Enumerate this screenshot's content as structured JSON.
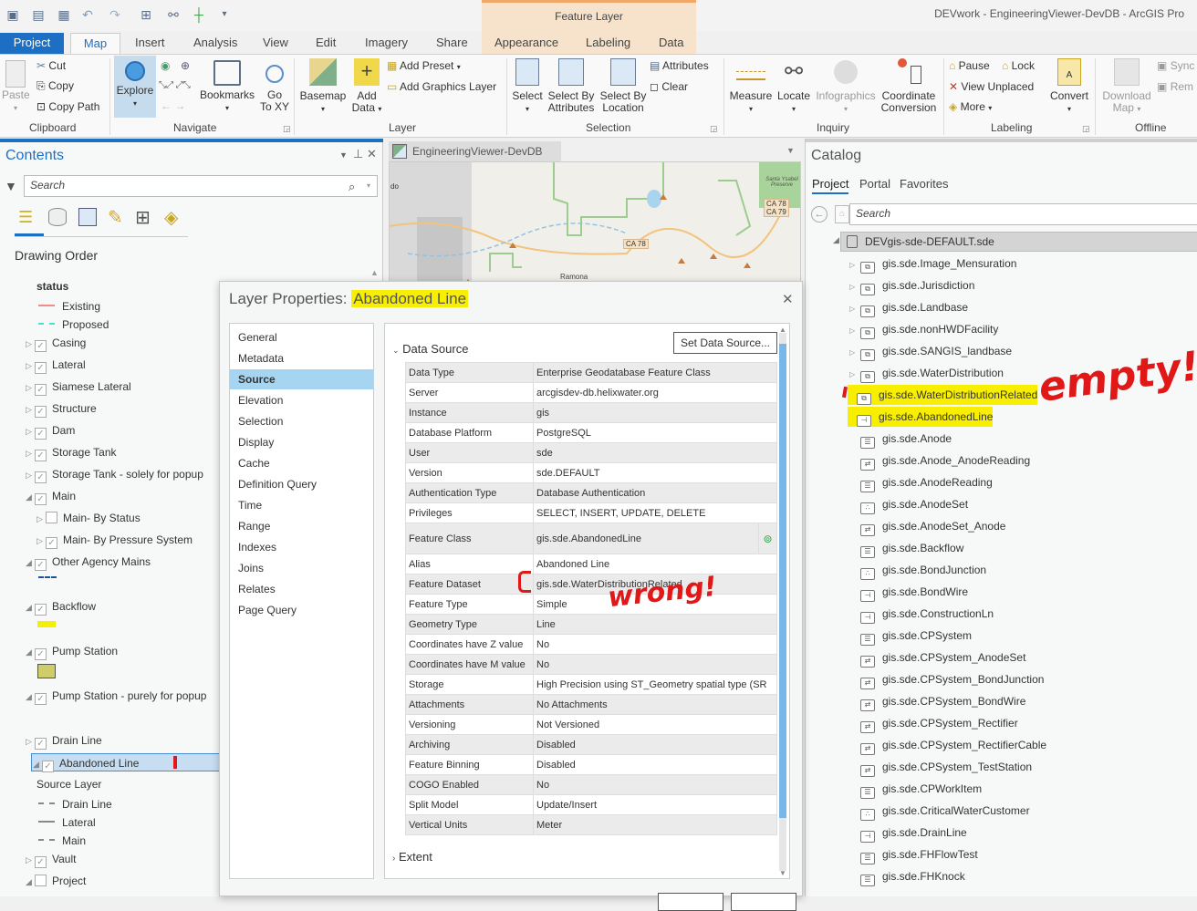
{
  "app": {
    "title": "DEVwork - EngineeringViewer-DevDB - ArcGIS Pro",
    "context_tab_group": "Feature Layer"
  },
  "ribbon_tabs": [
    "Project",
    "Map",
    "Insert",
    "Analysis",
    "View",
    "Edit",
    "Imagery",
    "Share",
    "Appearance",
    "Labeling",
    "Data"
  ],
  "ribbon": {
    "clipboard": {
      "label": "Clipboard",
      "paste": "Paste",
      "cut": "Cut",
      "copy": "Copy",
      "copy_path": "Copy Path"
    },
    "navigate": {
      "label": "Navigate",
      "explore": "Explore",
      "bookmarks": "Bookmarks",
      "go_to_xy_1": "Go",
      "go_to_xy_2": "To XY"
    },
    "layer": {
      "label": "Layer",
      "basemap": "Basemap",
      "add_data_1": "Add",
      "add_data_2": "Data",
      "add_preset": "Add Preset",
      "add_graphics_layer": "Add Graphics Layer"
    },
    "selection": {
      "label": "Selection",
      "select": "Select",
      "select_by_attr_1": "Select By",
      "select_by_attr_2": "Attributes",
      "select_by_loc_1": "Select By",
      "select_by_loc_2": "Location",
      "attributes": "Attributes",
      "clear": "Clear"
    },
    "inquiry": {
      "label": "Inquiry",
      "measure": "Measure",
      "locate": "Locate",
      "infographics": "Infographics",
      "coord_1": "Coordinate",
      "coord_2": "Conversion"
    },
    "labeling": {
      "label": "Labeling",
      "pause": "Pause",
      "lock": "Lock",
      "view_unplaced": "View Unplaced",
      "more": "More",
      "convert": "Convert"
    },
    "offline": {
      "label": "Offline",
      "download_1": "Download",
      "download_2": "Map",
      "sync": "Sync",
      "remove": "Rem"
    }
  },
  "contents": {
    "title": "Contents",
    "search_placeholder": "Search",
    "section": "Drawing Order",
    "items": [
      {
        "label": "status",
        "type": "heading"
      },
      {
        "label": "Existing",
        "type": "legend",
        "color": "#f08c8c"
      },
      {
        "label": "Proposed",
        "type": "legend",
        "color": "#40e8c8"
      },
      {
        "label": "Casing",
        "checked": true,
        "expanded": false
      },
      {
        "label": "Lateral",
        "checked": true,
        "expanded": false
      },
      {
        "label": "Siamese Lateral",
        "checked": true,
        "expanded": false
      },
      {
        "label": "Structure",
        "checked": true,
        "expanded": false
      },
      {
        "label": "Dam",
        "checked": true,
        "expanded": false
      },
      {
        "label": "Storage Tank",
        "checked": true,
        "expanded": false
      },
      {
        "label": "Storage Tank - solely for popup",
        "checked": true,
        "expanded": false
      },
      {
        "label": "Main",
        "checked": true,
        "expanded": true
      },
      {
        "label": "Main- By Status",
        "checked": false,
        "expanded": false
      },
      {
        "label": "Main- By Pressure System",
        "checked": true,
        "expanded": false
      },
      {
        "label": "Other Agency Mains",
        "checked": true,
        "expanded": true
      },
      {
        "label": "Backflow",
        "checked": true,
        "expanded": true
      },
      {
        "label": "Pump Station",
        "checked": true,
        "expanded": true
      },
      {
        "label": "Pump Station - purely for popup",
        "checked": true,
        "expanded": true
      },
      {
        "label": "Drain Line",
        "checked": true,
        "expanded": false
      },
      {
        "label": "Abandoned Line",
        "checked": true,
        "expanded": true,
        "selected": true
      },
      {
        "label": "Source Layer",
        "type": "heading"
      },
      {
        "label": "Drain Line",
        "type": "legend"
      },
      {
        "label": "Lateral",
        "type": "legend"
      },
      {
        "label": "Main",
        "type": "legend"
      },
      {
        "label": "Vault",
        "checked": true,
        "expanded": false
      },
      {
        "label": "Project",
        "checked": false,
        "expanded": true
      }
    ]
  },
  "map": {
    "tab_label": "EngineeringViewer-DevDB",
    "labels": [
      "CA 78",
      "CA 78",
      "CA 79",
      "Ramona",
      "Santa Ysabel Preserve",
      "do"
    ]
  },
  "dialog": {
    "title_prefix": "Layer Properties: ",
    "title_layer": "Abandoned Line",
    "nav": [
      "General",
      "Metadata",
      "Source",
      "Elevation",
      "Selection",
      "Display",
      "Cache",
      "Definition Query",
      "Time",
      "Range",
      "Indexes",
      "Joins",
      "Relates",
      "Page Query"
    ],
    "selected_nav": "Source",
    "section": "Data Source",
    "set_data_source": "Set Data Source...",
    "properties": [
      {
        "key": "Data Type",
        "value": "Enterprise Geodatabase Feature Class"
      },
      {
        "key": "Server",
        "value": "arcgisdev-db.helixwater.org"
      },
      {
        "key": "Instance",
        "value": "gis"
      },
      {
        "key": "Database Platform",
        "value": "PostgreSQL"
      },
      {
        "key": "User",
        "value": "sde"
      },
      {
        "key": "Version",
        "value": "sde.DEFAULT"
      },
      {
        "key": "Authentication Type",
        "value": "Database Authentication"
      },
      {
        "key": "Privileges",
        "value": "SELECT, INSERT, UPDATE, DELETE"
      },
      {
        "key": "Feature Class",
        "value": "gis.sde.AbandonedLine"
      },
      {
        "key": "Alias",
        "value": "Abandoned Line"
      },
      {
        "key": "Feature Dataset",
        "value": "gis.sde.WaterDistributionRelated"
      },
      {
        "key": "Feature Type",
        "value": "Simple"
      },
      {
        "key": "Geometry Type",
        "value": "Line"
      },
      {
        "key": "Coordinates have Z value",
        "value": "No"
      },
      {
        "key": "Coordinates have M value",
        "value": "No"
      },
      {
        "key": "Storage",
        "value": "High Precision using ST_Geometry spatial type (SR"
      },
      {
        "key": "Attachments",
        "value": "No Attachments"
      },
      {
        "key": "Versioning",
        "value": "Not Versioned"
      },
      {
        "key": "Archiving",
        "value": "Disabled"
      },
      {
        "key": "Feature Binning",
        "value": "Disabled"
      },
      {
        "key": "COGO Enabled",
        "value": "No"
      },
      {
        "key": "Split Model",
        "value": "Update/Insert"
      },
      {
        "key": "Vertical Units",
        "value": "Meter"
      }
    ],
    "extent_label": "Extent"
  },
  "catalog": {
    "title": "Catalog",
    "tabs": [
      "Project",
      "Portal",
      "Favorites"
    ],
    "search_placeholder": "Search",
    "root": "DEVgis-sde-DEFAULT.sde",
    "items": [
      {
        "label": "gis.sde.Image_Mensuration",
        "icon": "dataset",
        "expandable": true
      },
      {
        "label": "gis.sde.Jurisdiction",
        "icon": "dataset",
        "expandable": true
      },
      {
        "label": "gis.sde.Landbase",
        "icon": "dataset",
        "expandable": true
      },
      {
        "label": "gis.sde.nonHWDFacility",
        "icon": "dataset",
        "expandable": true
      },
      {
        "label": "gis.sde.SANGIS_landbase",
        "icon": "dataset",
        "expandable": true
      },
      {
        "label": "gis.sde.WaterDistribution",
        "icon": "dataset",
        "expandable": true
      },
      {
        "label": "gis.sde.WaterDistributionRelated",
        "icon": "dataset",
        "expandable": false,
        "highlighted": true
      },
      {
        "label": "gis.sde.AbandonedLine",
        "icon": "line",
        "expandable": false,
        "highlighted": true
      },
      {
        "label": "gis.sde.Anode",
        "icon": "table"
      },
      {
        "label": "gis.sde.Anode_AnodeReading",
        "icon": "relationship"
      },
      {
        "label": "gis.sde.AnodeReading",
        "icon": "table"
      },
      {
        "label": "gis.sde.AnodeSet",
        "icon": "point"
      },
      {
        "label": "gis.sde.AnodeSet_Anode",
        "icon": "relationship"
      },
      {
        "label": "gis.sde.Backflow",
        "icon": "table"
      },
      {
        "label": "gis.sde.BondJunction",
        "icon": "point"
      },
      {
        "label": "gis.sde.BondWire",
        "icon": "line"
      },
      {
        "label": "gis.sde.ConstructionLn",
        "icon": "line"
      },
      {
        "label": "gis.sde.CPSystem",
        "icon": "table"
      },
      {
        "label": "gis.sde.CPSystem_AnodeSet",
        "icon": "relationship"
      },
      {
        "label": "gis.sde.CPSystem_BondJunction",
        "icon": "relationship"
      },
      {
        "label": "gis.sde.CPSystem_BondWire",
        "icon": "relationship"
      },
      {
        "label": "gis.sde.CPSystem_Rectifier",
        "icon": "relationship"
      },
      {
        "label": "gis.sde.CPSystem_RectifierCable",
        "icon": "relationship"
      },
      {
        "label": "gis.sde.CPSystem_TestStation",
        "icon": "relationship"
      },
      {
        "label": "gis.sde.CPWorkItem",
        "icon": "table"
      },
      {
        "label": "gis.sde.CriticalWaterCustomer",
        "icon": "point"
      },
      {
        "label": "gis.sde.DrainLine",
        "icon": "line"
      },
      {
        "label": "gis.sde.FHFlowTest",
        "icon": "table"
      },
      {
        "label": "gis.sde.FHKnock",
        "icon": "table"
      }
    ]
  },
  "annotations": {
    "empty": "empty!",
    "wrong": "wrong!"
  },
  "colors": {
    "accent": "#1d6fc4",
    "highlight": "#f8ef00",
    "selection": "#a6d5f2",
    "annotation": "#e01818"
  }
}
